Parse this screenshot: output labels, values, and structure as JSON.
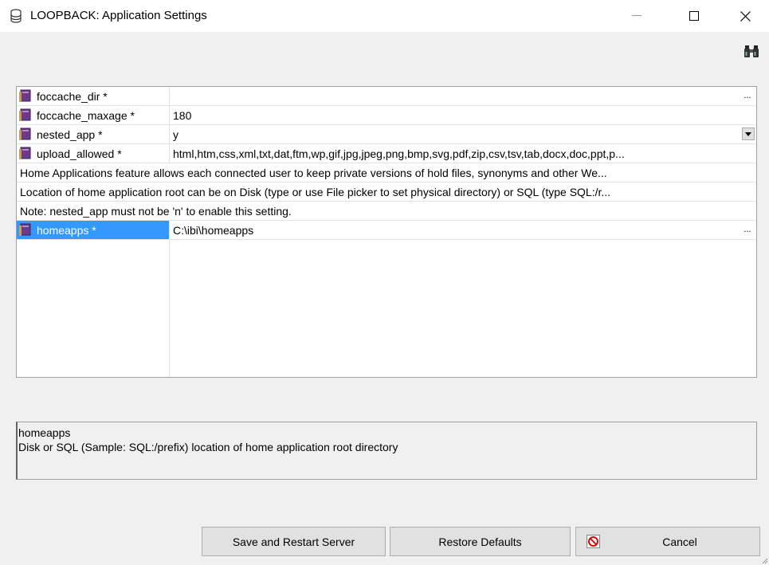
{
  "window": {
    "title": "LOOPBACK: Application Settings",
    "minimize_glyph": "—",
    "maximize_glyph": "☐",
    "close_glyph": "✕"
  },
  "toolbar": {
    "find_icon": "binoculars-icon"
  },
  "settings": {
    "ellipsis": "...",
    "rows": [
      {
        "name": "foccache_dir *",
        "value": ""
      },
      {
        "name": "foccache_maxage *",
        "value": "180"
      },
      {
        "name": "nested_app *",
        "value": "y"
      },
      {
        "name": "upload_allowed *",
        "value": "html,htm,css,xml,txt,dat,ftm,wp,gif,jpg,jpeg,png,bmp,svg,pdf,zip,csv,tsv,tab,docx,doc,ppt,p..."
      },
      {
        "text": "Home Applications feature allows each connected user to keep private versions of hold files, synonyms and other We..."
      },
      {
        "text": "Location of home application root can be on Disk (type or use File picker to set physical directory) or SQL (type SQL:/r..."
      },
      {
        "text": "Note: nested_app must not be 'n' to enable this setting."
      },
      {
        "name": "homeapps *",
        "value": "C:\\ibi\\homeapps"
      }
    ]
  },
  "description": {
    "title": "homeapps",
    "text": "Disk or SQL (Sample: SQL:/prefix) location of home application root directory"
  },
  "buttons": {
    "save": "Save and Restart Server",
    "restore": "Restore Defaults",
    "cancel": "Cancel"
  },
  "colors": {
    "selection": "#3399ff",
    "background": "#f0f0f0",
    "grid_line": "#e3e3e3"
  }
}
